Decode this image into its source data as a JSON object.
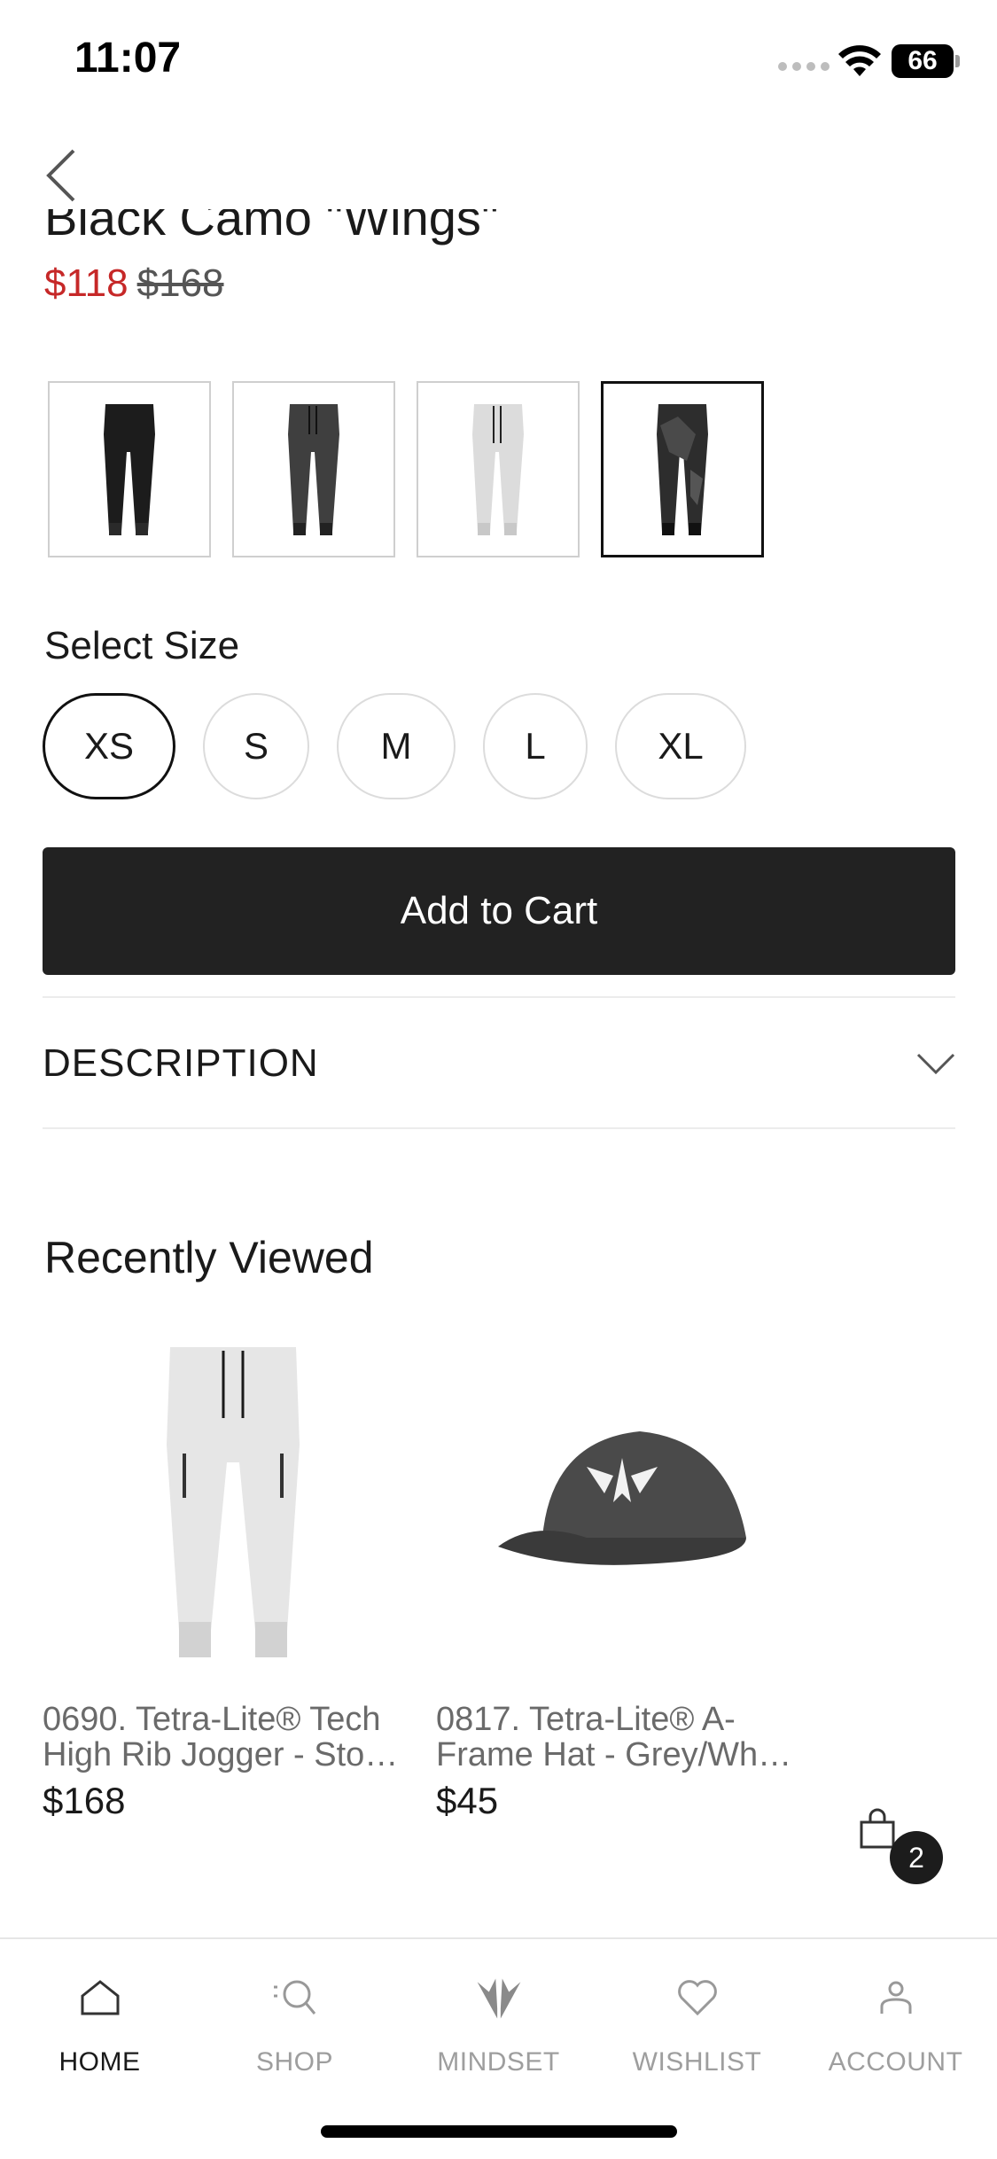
{
  "status": {
    "time": "11:07",
    "battery": "66"
  },
  "product": {
    "title": "Black Camo \"Wings\"",
    "sale_price": "$118",
    "original_price": "$168"
  },
  "swatches": [
    {
      "name": "Black",
      "selected": false
    },
    {
      "name": "Charcoal",
      "selected": false
    },
    {
      "name": "Stone",
      "selected": false
    },
    {
      "name": "Black Camo",
      "selected": true
    }
  ],
  "size_selector": {
    "label": "Select Size",
    "sizes": [
      "XS",
      "S",
      "M",
      "L",
      "XL"
    ],
    "selected": "XS"
  },
  "add_to_cart_label": "Add to Cart",
  "description": {
    "label": "DESCRIPTION"
  },
  "recently_viewed": {
    "heading": "Recently Viewed",
    "items": [
      {
        "name_line1": "0690. Tetra-Lite® Tech",
        "name_line2": "High Rib Jogger - Sto…",
        "price": "$168"
      },
      {
        "name_line1": "0817. Tetra-Lite® A-",
        "name_line2": "Frame Hat - Grey/Wh…",
        "price": "$45"
      }
    ]
  },
  "cart": {
    "count": "2"
  },
  "tabs": [
    {
      "label": "HOME",
      "icon": "home-icon",
      "active": true
    },
    {
      "label": "SHOP",
      "icon": "search-icon",
      "active": false
    },
    {
      "label": "MINDSET",
      "icon": "wings-logo-icon",
      "active": false
    },
    {
      "label": "WISHLIST",
      "icon": "heart-icon",
      "active": false
    },
    {
      "label": "ACCOUNT",
      "icon": "person-icon",
      "active": false
    }
  ],
  "colors": {
    "sale": "#c62828",
    "button": "#222222",
    "muted": "#9e9e9e"
  }
}
